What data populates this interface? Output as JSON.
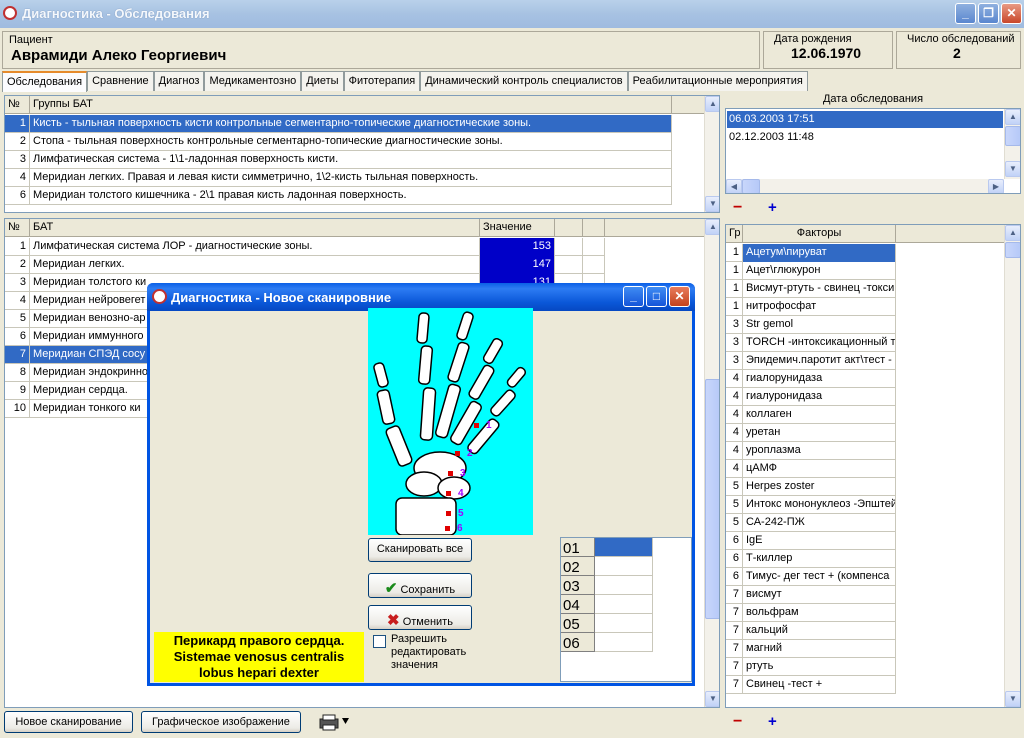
{
  "app": {
    "title": "Диагностика - Обследования"
  },
  "patient": {
    "label": "Пациент",
    "name": "Аврамиди Алеко Георгиевич"
  },
  "birth": {
    "label": "Дата рождения",
    "value": "12.06.1970"
  },
  "exams": {
    "label": "Число обследований",
    "value": "2"
  },
  "tabs": [
    "Обследования",
    "Сравнение",
    "Диагноз",
    "Медикаментозно",
    "Диеты",
    "Фитотерапия",
    "Динамический контроль специалистов",
    "Реабилитационные мероприятия"
  ],
  "groups": {
    "headers": {
      "num": "№",
      "name": "Группы БАТ"
    },
    "rows": [
      {
        "num": "1",
        "name": "Кисть - тыльная поверхность кисти контрольные сегментарно-топические диагностические зоны."
      },
      {
        "num": "2",
        "name": "Стопа - тыльная поверхность контрольные сегментарно-топические диагностические зоны."
      },
      {
        "num": "3",
        "name": "Лимфатическая система - 1\\1-ладонная поверхность кисти."
      },
      {
        "num": "4",
        "name": "Меридиан легких. Правая и левая кисти симметрично, 1\\2-кисть тыльная поверхность."
      },
      {
        "num": "6",
        "name": "Меридиан толстого кишечника - 2\\1 правая кисть ладонная поверхность."
      }
    ]
  },
  "bat": {
    "headers": {
      "num": "№",
      "name": "БАТ",
      "value": "Значение"
    },
    "rows": [
      {
        "num": "1",
        "name": "Лимфатическая система ЛОР - диагностические зоны.",
        "value": "153"
      },
      {
        "num": "2",
        "name": "Меридиан легких.",
        "value": "147"
      },
      {
        "num": "3",
        "name": "Меридиан толстого ки",
        "value": "131"
      },
      {
        "num": "4",
        "name": "Меридиан нейровегет",
        "value": ""
      },
      {
        "num": "5",
        "name": "Меридиан венозно-ар",
        "value": ""
      },
      {
        "num": "6",
        "name": "Меридиан иммунного",
        "value": ""
      },
      {
        "num": "7",
        "name": "Меридиан СПЭД сосу",
        "value": ""
      },
      {
        "num": "8",
        "name": "Меридиан эндокринно",
        "value": ""
      },
      {
        "num": "9",
        "name": "Меридиан сердца.",
        "value": ""
      },
      {
        "num": "10",
        "name": "Меридиан тонкого ки",
        "value": ""
      }
    ]
  },
  "dates": {
    "label": "Дата обследования",
    "items": [
      "06.03.2003 17:51",
      "02.12.2003 11:48"
    ]
  },
  "factors": {
    "headers": {
      "num": "Гр",
      "name": "Факторы"
    },
    "rows": [
      {
        "num": "1",
        "name": "Ацетум\\пируват"
      },
      {
        "num": "1",
        "name": "Ацет\\глюкурон"
      },
      {
        "num": "1",
        "name": "Висмут-ртуть - свинец -токси"
      },
      {
        "num": "1",
        "name": "нитрофосфат"
      },
      {
        "num": "3",
        "name": "Str gemol"
      },
      {
        "num": "3",
        "name": "TORCH -интоксикационный т"
      },
      {
        "num": "3",
        "name": "Эпидемич.паротит  акт\\тест -"
      },
      {
        "num": "4",
        "name": "гиалорунидаза"
      },
      {
        "num": "4",
        "name": "гиалуронидаза"
      },
      {
        "num": "4",
        "name": "коллаген"
      },
      {
        "num": "4",
        "name": "уретан"
      },
      {
        "num": "4",
        "name": "уроплазма"
      },
      {
        "num": "4",
        "name": "цАМФ"
      },
      {
        "num": "5",
        "name": "Herpes zoster"
      },
      {
        "num": "5",
        "name": "Интокс мононуклеоз -Эпштей"
      },
      {
        "num": "5",
        "name": "СА-242-ПЖ"
      },
      {
        "num": "6",
        "name": "IgE"
      },
      {
        "num": "6",
        "name": "Т-киллер"
      },
      {
        "num": "6",
        "name": "Тимус- дег тест + (компенса"
      },
      {
        "num": "7",
        "name": "висмут"
      },
      {
        "num": "7",
        "name": "вольфрам"
      },
      {
        "num": "7",
        "name": "кальций"
      },
      {
        "num": "7",
        "name": "магний"
      },
      {
        "num": "7",
        "name": "ртуть"
      },
      {
        "num": "7",
        "name": "Свинец -тест +"
      }
    ]
  },
  "bottom": {
    "new_scan": "Новое сканирование",
    "graphic": "Графическое изображение"
  },
  "dialog": {
    "title": "Диагностика - Новое сканировние",
    "scan_all": "Сканировать все",
    "save": "Сохранить",
    "cancel": "Отменить",
    "allow_edit": "Разрешить редактировать значения",
    "yellow": [
      "Перикард правого сердца.",
      "Sistemae venosus centralis",
      "lobus hepari dexter"
    ],
    "scan_rows": [
      "01",
      "02",
      "03",
      "04",
      "05",
      "06"
    ],
    "points": [
      "1",
      "2",
      "3",
      "4",
      "5",
      "6"
    ]
  }
}
